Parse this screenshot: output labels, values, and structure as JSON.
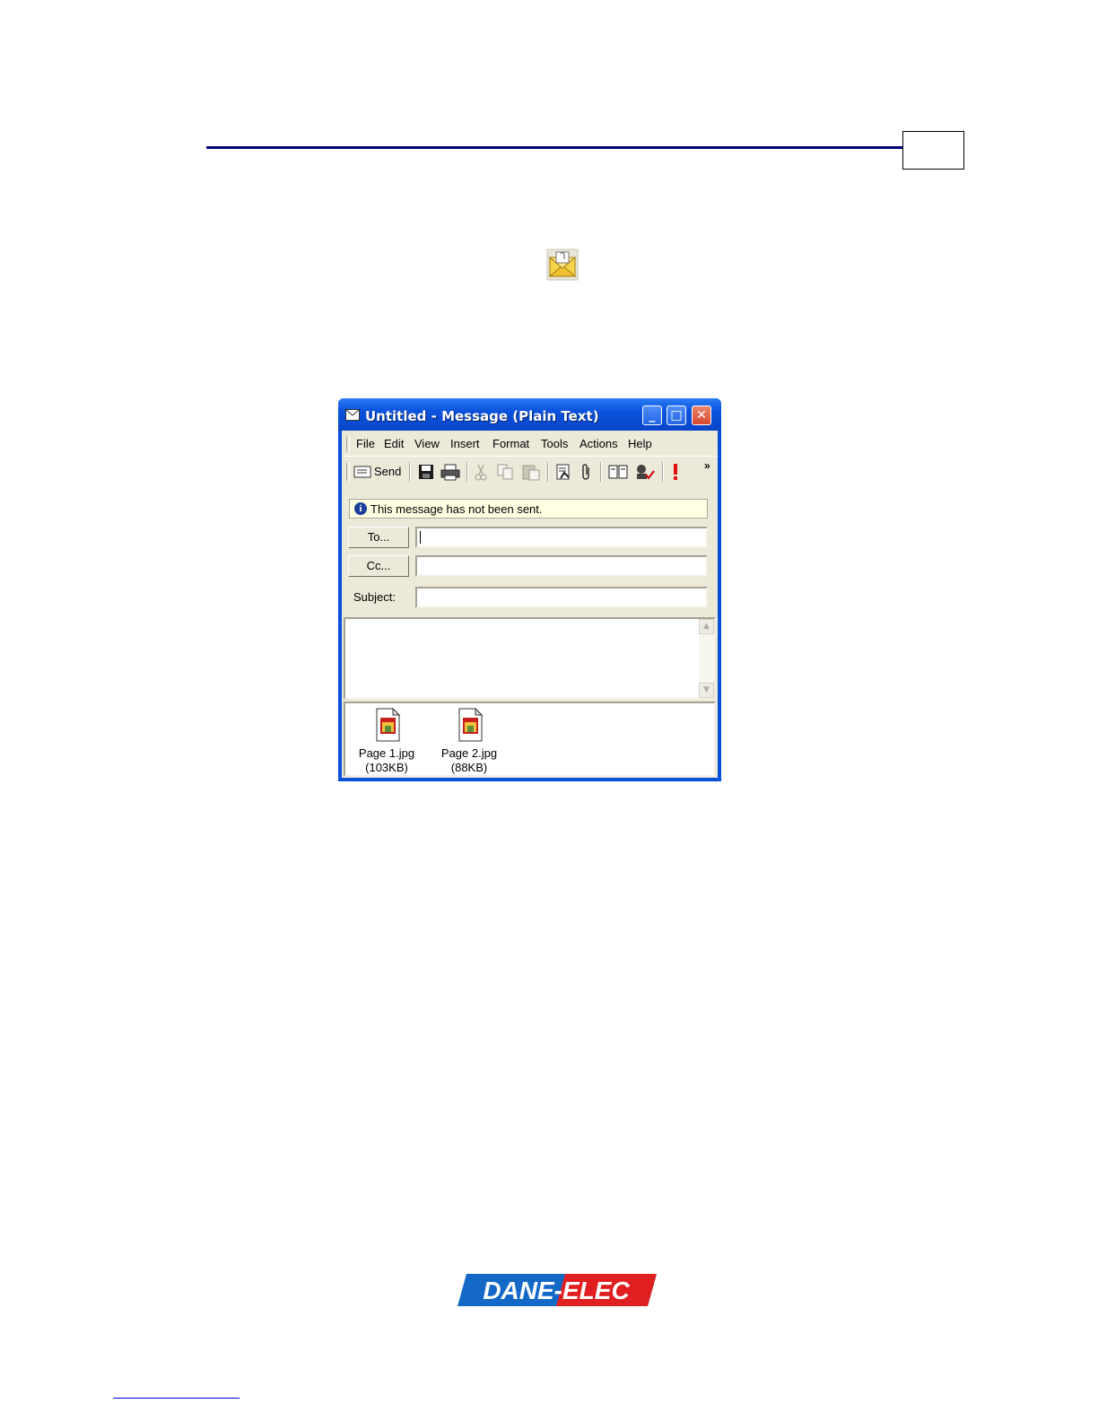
{
  "document": {
    "logo_text": "DANE-ELEC"
  },
  "window": {
    "title": "Untitled - Message (Plain Text)",
    "min_glyph": "_",
    "max_glyph": "□",
    "close_glyph": "✕",
    "menu": [
      "File",
      "Edit",
      "View",
      "Insert",
      "Format",
      "Tools",
      "Actions",
      "Help"
    ],
    "toolbar": {
      "send_label": "Send",
      "overflow_glyph": "»"
    },
    "info_text": "This message has not been sent.",
    "to_button": "To...",
    "cc_button": "Cc...",
    "subject_label": "Subject:",
    "to_value": "",
    "cc_value": "",
    "subject_value": "",
    "attachments": [
      {
        "name": "Page 1.jpg",
        "size": "(103KB)"
      },
      {
        "name": "Page 2.jpg",
        "size": "(88KB)"
      }
    ]
  },
  "colors": {
    "header_rule": "#00007a",
    "titlebar": "#0a52dc",
    "logo_blue": "#1469c7",
    "logo_red": "#e02020"
  }
}
